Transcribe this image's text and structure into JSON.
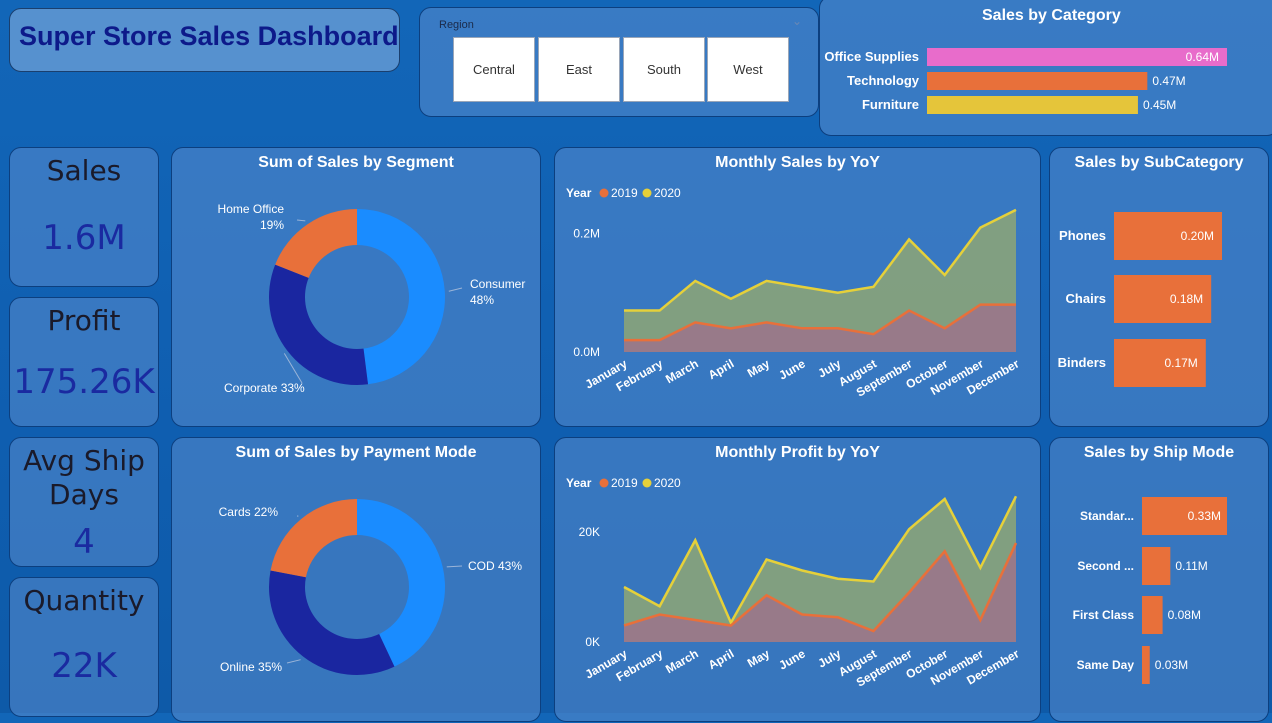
{
  "dashboard_title": "Super Store Sales Dashboard",
  "region_slicer": {
    "label": "Region",
    "options": [
      "Central",
      "East",
      "South",
      "West"
    ]
  },
  "kpis": {
    "sales": {
      "label": "Sales",
      "value": "1.6M"
    },
    "profit": {
      "label": "Profit",
      "value": "175.26K"
    },
    "avg_ship_days": {
      "label_line1": "Avg Ship",
      "label_line2": "Days",
      "value": "4"
    },
    "quantity": {
      "label": "Quantity",
      "value": "22K"
    }
  },
  "colors": {
    "pink": "#e86ccb",
    "orange": "#e8703a",
    "yellow": "#e5c53a",
    "light_blue": "#1a8cff",
    "dark_blue": "#1a26a0",
    "series_2019": "#e8703a",
    "series_2020": "#e5d03a"
  },
  "chart_data": [
    {
      "id": "category",
      "type": "bar",
      "orientation": "horizontal",
      "title": "Sales by Category",
      "categories": [
        "Office Supplies",
        "Technology",
        "Furniture"
      ],
      "values": [
        0.64,
        0.47,
        0.45
      ],
      "labels": [
        "0.64M",
        "0.47M",
        "0.45M"
      ],
      "bar_colors": [
        "#e86ccb",
        "#e8703a",
        "#e5c53a"
      ],
      "xlim": [
        0,
        0.64
      ]
    },
    {
      "id": "segment",
      "type": "pie",
      "title": "Sum of Sales by Segment",
      "slices": [
        {
          "name": "Consumer",
          "pct": "48%",
          "value": 48,
          "color": "#1a8cff"
        },
        {
          "name": "Corporate",
          "pct": "33%",
          "value": 33,
          "color": "#1a26a0"
        },
        {
          "name": "Home Office",
          "pct": "19%",
          "value": 19,
          "color": "#e8703a"
        }
      ]
    },
    {
      "id": "monthly_sales",
      "type": "area",
      "title": "Monthly Sales by YoY",
      "legend_title": "Year",
      "categories": [
        "January",
        "February",
        "March",
        "April",
        "May",
        "June",
        "July",
        "August",
        "September",
        "October",
        "November",
        "December"
      ],
      "series": [
        {
          "name": "2019",
          "values": [
            0.02,
            0.02,
            0.05,
            0.04,
            0.05,
            0.04,
            0.04,
            0.03,
            0.07,
            0.04,
            0.08,
            0.08
          ]
        },
        {
          "name": "2020",
          "values": [
            0.07,
            0.07,
            0.12,
            0.09,
            0.12,
            0.11,
            0.1,
            0.11,
            0.19,
            0.13,
            0.21,
            0.24
          ]
        }
      ],
      "yticks": [
        "0.0M",
        "0.2M"
      ],
      "ytick_values": [
        0,
        0.2
      ],
      "ylim": [
        0,
        0.26
      ]
    },
    {
      "id": "subcategory",
      "type": "bar",
      "orientation": "vertical-list",
      "title": "Sales by SubCategory",
      "categories": [
        "Phones",
        "Chairs",
        "Binders"
      ],
      "values": [
        0.2,
        0.18,
        0.17
      ],
      "labels": [
        "0.20M",
        "0.18M",
        "0.17M"
      ],
      "xlim": [
        0,
        0.2
      ]
    },
    {
      "id": "payment",
      "type": "pie",
      "title": "Sum of Sales by Payment Mode",
      "slices": [
        {
          "name": "COD",
          "pct": "43%",
          "value": 43,
          "color": "#1a8cff"
        },
        {
          "name": "Online",
          "pct": "35%",
          "value": 35,
          "color": "#1a26a0"
        },
        {
          "name": "Cards",
          "pct": "22%",
          "value": 22,
          "color": "#e8703a"
        }
      ]
    },
    {
      "id": "monthly_profit",
      "type": "area",
      "title": "Monthly Profit by YoY",
      "legend_title": "Year",
      "categories": [
        "January",
        "February",
        "March",
        "April",
        "May",
        "June",
        "July",
        "August",
        "September",
        "October",
        "November",
        "December"
      ],
      "series": [
        {
          "name": "2019",
          "values": [
            3000,
            5000,
            4000,
            3000,
            8500,
            5000,
            4500,
            2000,
            9000,
            16500,
            4000,
            18000
          ]
        },
        {
          "name": "2020",
          "values": [
            10000,
            6500,
            18500,
            3500,
            15000,
            13000,
            11500,
            11000,
            20500,
            26000,
            13500,
            26500
          ]
        }
      ],
      "yticks": [
        "0K",
        "20K"
      ],
      "ytick_values": [
        0,
        20000
      ],
      "ylim": [
        0,
        28000
      ]
    },
    {
      "id": "shipmode",
      "type": "bar",
      "orientation": "vertical-list",
      "title": "Sales by Ship Mode",
      "categories": [
        "Standar...",
        "Second ...",
        "First Class",
        "Same Day"
      ],
      "values": [
        0.33,
        0.11,
        0.08,
        0.03
      ],
      "labels": [
        "0.33M",
        "0.11M",
        "0.08M",
        "0.03M"
      ],
      "xlim": [
        0,
        0.33
      ]
    }
  ]
}
